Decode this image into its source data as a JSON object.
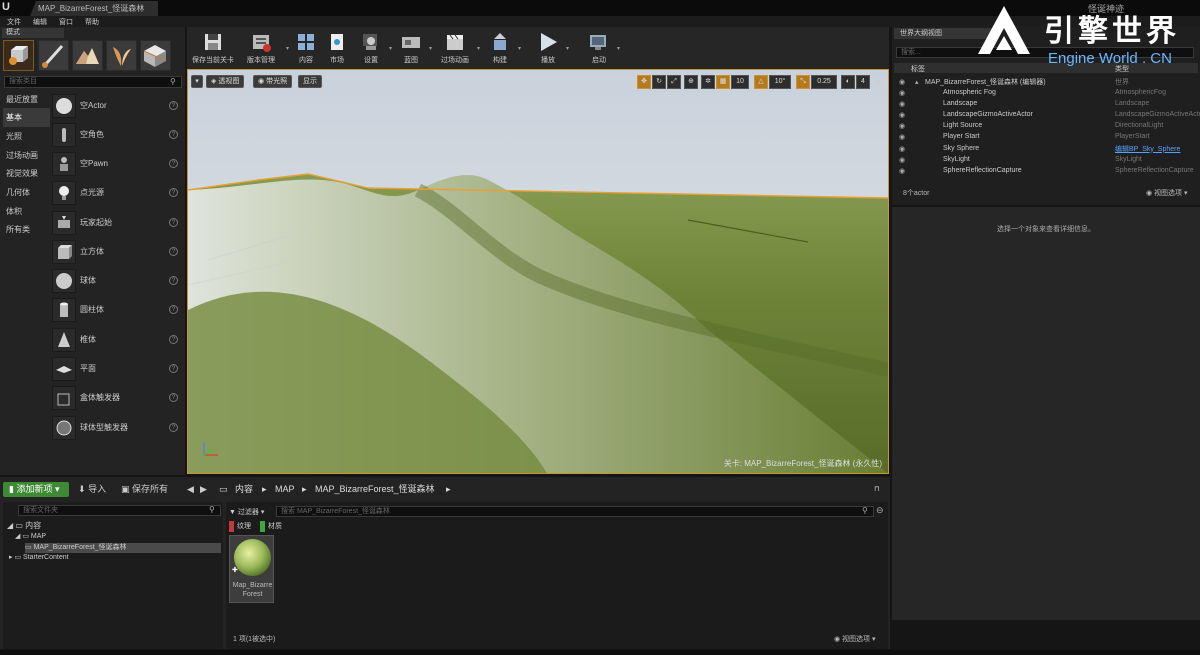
{
  "window": {
    "doc_tab": "MAP_BizarreForest_怪诞森林",
    "project": "怪诞神迹"
  },
  "menu": [
    "文件",
    "编辑",
    "窗口",
    "帮助"
  ],
  "modes": {
    "tab": "模式",
    "search_placeholder": "搜索类目",
    "categories": [
      "最近放置",
      "基本",
      "光照",
      "过场动画",
      "视觉效果",
      "几何体",
      "体积",
      "所有类"
    ],
    "items": [
      "空Actor",
      "空角色",
      "空Pawn",
      "点光源",
      "玩家起始",
      "立方体",
      "球体",
      "圆柱体",
      "椎体",
      "平面",
      "盒体触发器",
      "球体型触发器"
    ]
  },
  "toolbar": [
    "保存当前关卡",
    "版本管理",
    "内容",
    "市场",
    "设置",
    "蓝图",
    "过场动画",
    "构建",
    "播放",
    "启动"
  ],
  "viewport": {
    "buttons": [
      "透视图",
      "带光照",
      "显示"
    ],
    "snap_grid": "10",
    "snap_rot": "10°",
    "snap_scale": "0.25",
    "cam_speed": "4",
    "level_label": "关卡:  MAP_BizarreForest_怪诞森林 (永久性)"
  },
  "outliner": {
    "tab": "世界大纲视图",
    "search_placeholder": "搜索...",
    "col_label": "标签",
    "col_type": "类型",
    "rows": [
      {
        "name": "MAP_BizarreForest_怪诞森林 (编辑器)",
        "type": "世界"
      },
      {
        "name": "Atmospheric Fog",
        "type": "AtmosphericFog"
      },
      {
        "name": "Landscape",
        "type": "Landscape"
      },
      {
        "name": "LandscapeGizmoActiveActor",
        "type": "LandscapeGizmoActiveActor"
      },
      {
        "name": "Light Source",
        "type": "DirectionalLight"
      },
      {
        "name": "Player Start",
        "type": "PlayerStart"
      },
      {
        "name": "Sky Sphere",
        "type": "编辑BP_Sky_Sphere"
      },
      {
        "name": "SkyLight",
        "type": "SkyLight"
      },
      {
        "name": "SphereReflectionCapture",
        "type": "SphereReflectionCapture"
      }
    ],
    "count": "8个actor",
    "view_options": "视图选项"
  },
  "details": {
    "message": "选择一个对象来查看详细信息。"
  },
  "content_browser": {
    "add_new": "添加新项",
    "import": "导入",
    "save_all": "保存所有",
    "crumbs": [
      "内容",
      "MAP",
      "MAP_BizarreForest_怪诞森林"
    ],
    "folder_search": "搜索文件夹",
    "tree": [
      "内容",
      "MAP",
      "MAP_BizarreForest_怪诞森林",
      "StarterContent"
    ],
    "filters": "过滤器",
    "asset_search": "搜索 MAP_BizarreForest_怪诞森林",
    "tags": [
      {
        "label": "纹理",
        "color": "#c23a3a"
      },
      {
        "label": "材质",
        "color": "#3ea83e"
      }
    ],
    "asset_name": "Map_Bizarre Forest",
    "item_count": "1 项(1被选中)",
    "view_options": "视图选项"
  },
  "watermark": {
    "cn": "引擎世界",
    "en": "Engine World . CN"
  }
}
